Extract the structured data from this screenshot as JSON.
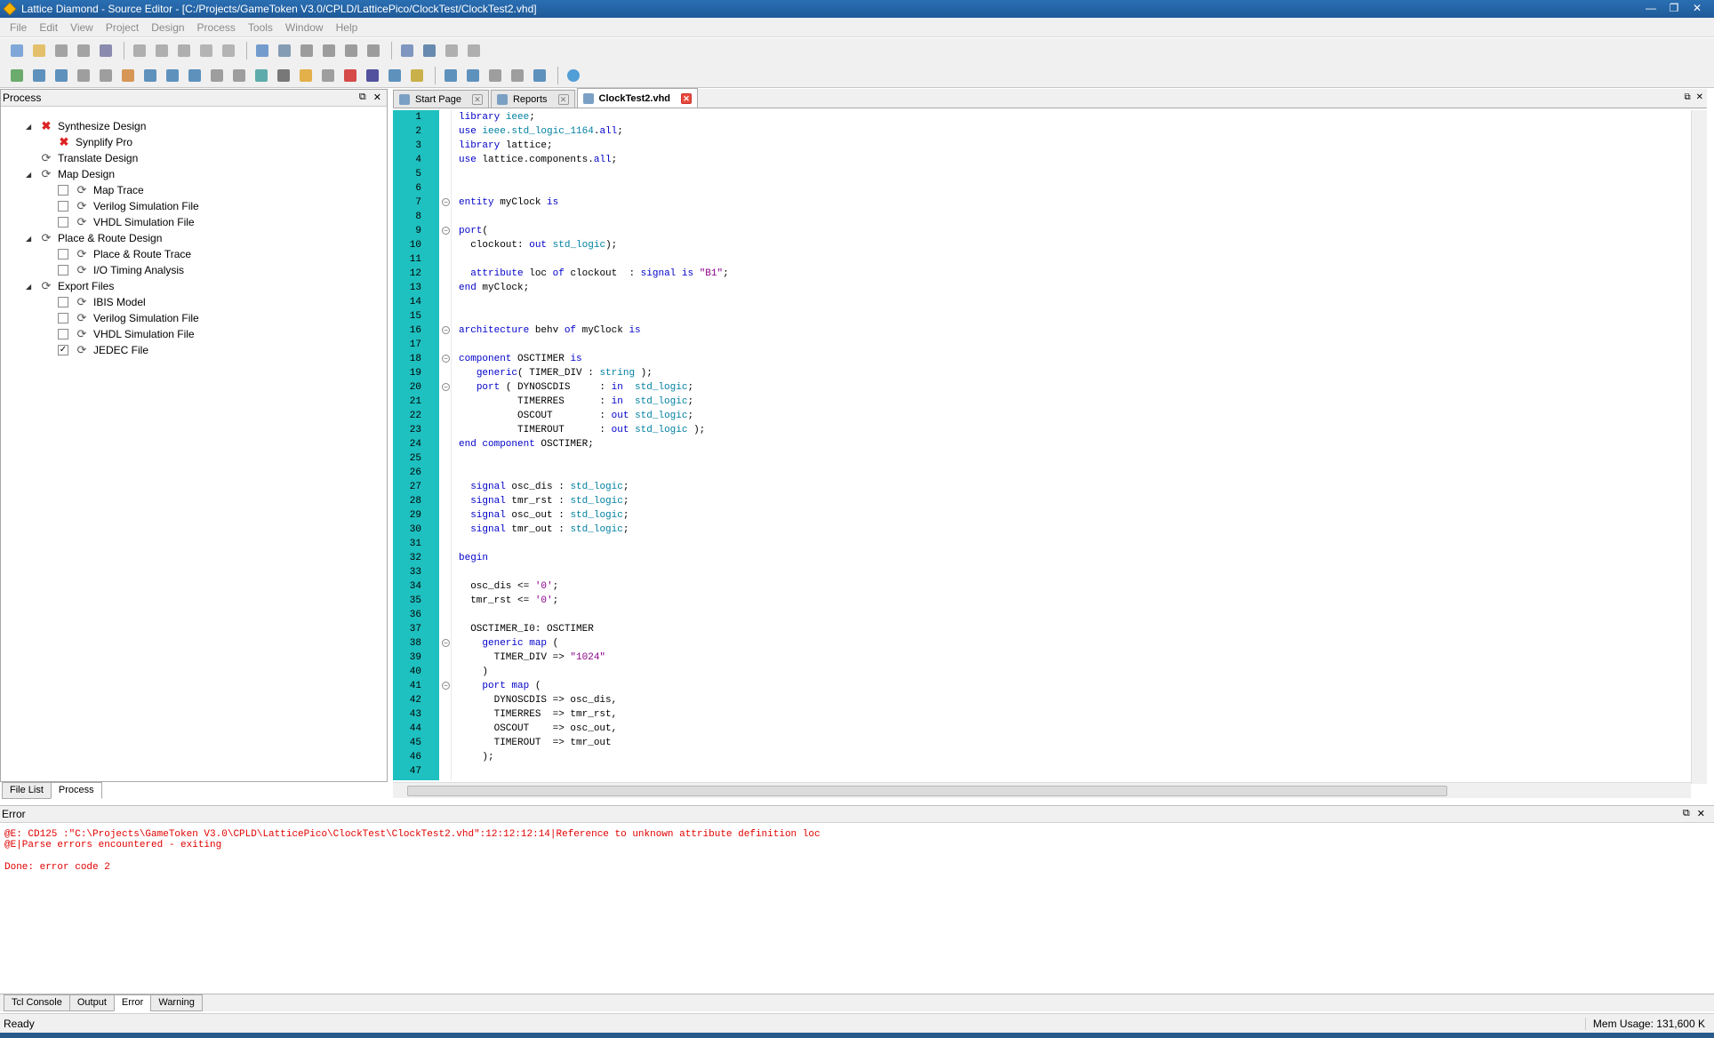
{
  "window": {
    "title": "Lattice Diamond - Source Editor - [C:/Projects/GameToken V3.0/CPLD/LatticePico/ClockTest/ClockTest2.vhd]",
    "btn_min": "—",
    "btn_max": "❐",
    "btn_close": "✕"
  },
  "menu": [
    "File",
    "Edit",
    "View",
    "Project",
    "Design",
    "Process",
    "Tools",
    "Window",
    "Help"
  ],
  "process_panel": {
    "title": "Process",
    "restore": "⧉",
    "close": "✕",
    "items": [
      {
        "label": "Synthesize Design",
        "level": 0,
        "exp": "◢",
        "icon": "✖",
        "err": true
      },
      {
        "label": "Synplify Pro",
        "level": 1,
        "icon": "✖",
        "err": true
      },
      {
        "label": "Translate Design",
        "level": 0,
        "icon": "⟳"
      },
      {
        "label": "Map Design",
        "level": 0,
        "exp": "◢",
        "icon": "⟳"
      },
      {
        "label": "Map Trace",
        "level": 2,
        "check": "",
        "icon": "⟳"
      },
      {
        "label": "Verilog Simulation File",
        "level": 2,
        "check": "",
        "icon": "⟳"
      },
      {
        "label": "VHDL Simulation File",
        "level": 2,
        "check": "",
        "icon": "⟳"
      },
      {
        "label": "Place & Route Design",
        "level": 0,
        "exp": "◢",
        "icon": "⟳"
      },
      {
        "label": "Place & Route Trace",
        "level": 2,
        "check": "",
        "icon": "⟳"
      },
      {
        "label": "I/O Timing Analysis",
        "level": 2,
        "check": "",
        "icon": "⟳"
      },
      {
        "label": "Export Files",
        "level": 0,
        "exp": "◢",
        "icon": "⟳"
      },
      {
        "label": "IBIS Model",
        "level": 2,
        "check": "",
        "icon": "⟳"
      },
      {
        "label": "Verilog Simulation File",
        "level": 2,
        "check": "",
        "icon": "⟳"
      },
      {
        "label": "VHDL Simulation File",
        "level": 2,
        "check": "",
        "icon": "⟳"
      },
      {
        "label": "JEDEC File",
        "level": 2,
        "check": "✓",
        "icon": "⟳"
      }
    ]
  },
  "left_tabs": [
    "File List",
    "Process"
  ],
  "editor_tabs": [
    {
      "label": "Start Page",
      "active": false
    },
    {
      "label": "Reports",
      "active": false
    },
    {
      "label": "ClockTest2.vhd",
      "active": true
    }
  ],
  "tab_close": "✕",
  "code_lines": [
    "<span class='kw'>library</span> <span class='ty'>ieee</span>;",
    "<span class='kw'>use</span> <span class='ty'>ieee.std_logic_1164</span>.<span class='kw'>all</span>;",
    "<span class='kw'>library</span> lattice;",
    "<span class='kw'>use</span> lattice.components.<span class='kw'>all</span>;",
    "",
    "",
    "<span class='kw'>entity</span> myClock <span class='kw'>is</span>",
    "",
    "<span class='kw'>port</span>(",
    "  clockout: <span class='kw'>out</span> <span class='ty'>std_logic</span>);",
    "",
    "  <span class='kw'>attribute</span> loc <span class='kw'>of</span> clockout  : <span class='kw'>signal</span> <span class='kw'>is</span> <span class='st'>\"B1\"</span>;",
    "<span class='kw'>end</span> myClock;",
    "",
    "",
    "<span class='kw'>architecture</span> behv <span class='kw'>of</span> myClock <span class='kw'>is</span>",
    "",
    "<span class='kw'>component</span> OSCTIMER <span class='kw'>is</span>",
    "   <span class='kw'>generic</span>( TIMER_DIV : <span class='ty'>string</span> );",
    "   <span class='kw'>port</span> ( DYNOSCDIS     : <span class='kw'>in</span>  <span class='ty'>std_logic</span>;",
    "          TIMERRES      : <span class='kw'>in</span>  <span class='ty'>std_logic</span>;",
    "          OSCOUT        : <span class='kw'>out</span> <span class='ty'>std_logic</span>;",
    "          TIMEROUT      : <span class='kw'>out</span> <span class='ty'>std_logic</span> );",
    "<span class='kw'>end component</span> OSCTIMER;",
    "",
    "",
    "  <span class='kw'>signal</span> osc_dis : <span class='ty'>std_logic</span>;",
    "  <span class='kw'>signal</span> tmr_rst : <span class='ty'>std_logic</span>;",
    "  <span class='kw'>signal</span> osc_out : <span class='ty'>std_logic</span>;",
    "  <span class='kw'>signal</span> tmr_out : <span class='ty'>std_logic</span>;",
    "",
    "<span class='kw'>begin</span>",
    "",
    "  osc_dis &lt;= <span class='st'>'0'</span>;",
    "  tmr_rst &lt;= <span class='st'>'0'</span>;",
    "",
    "  OSCTIMER_I0: OSCTIMER",
    "    <span class='kw'>generic map</span> (",
    "      TIMER_DIV =&gt; <span class='st'>\"1024\"</span>",
    "    )",
    "    <span class='kw'>port map</span> (",
    "      DYNOSCDIS =&gt; osc_dis,",
    "      TIMERRES  =&gt; tmr_rst,",
    "      OSCOUT    =&gt; osc_out,",
    "      TIMEROUT  =&gt; tmr_out",
    "    );",
    ""
  ],
  "fold_lines": [
    7,
    9,
    16,
    18,
    20,
    38,
    41
  ],
  "error_panel": {
    "title": "Error",
    "restore": "⧉",
    "close": "✕",
    "lines": [
      "@E: CD125 :\"C:\\Projects\\GameToken V3.0\\CPLD\\LatticePico\\ClockTest\\ClockTest2.vhd\":12:12:12:14|Reference to unknown attribute definition loc",
      "@E|Parse errors encountered - exiting",
      "",
      "Done: error code 2"
    ]
  },
  "bottom_tabs": [
    {
      "label": "Tcl Console",
      "active": false
    },
    {
      "label": "Output",
      "active": false
    },
    {
      "label": "Error",
      "active": true
    },
    {
      "label": "Warning",
      "active": false
    }
  ],
  "status": {
    "text": "Ready",
    "mem": "Mem Usage: 131,600 K"
  },
  "toolbar_icons": [
    "new-file-icon",
    "open-icon",
    "save-icon",
    "save-all-icon",
    "print-icon",
    "undo-icon",
    "redo-icon",
    "cut-icon",
    "copy-icon",
    "paste-icon",
    "find-icon",
    "replace-icon",
    "zoom-in-icon",
    "zoom-out-icon",
    "zoom-fit-icon",
    "zoom-icon",
    "task-icon",
    "run-icon",
    "check-icon",
    "settings-icon"
  ]
}
